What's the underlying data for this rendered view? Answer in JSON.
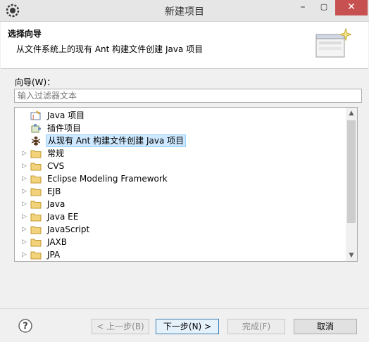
{
  "window": {
    "title": "新建项目",
    "minimize": "–",
    "maximize": "▢",
    "close": "✕"
  },
  "header": {
    "title": "选择向导",
    "description": "从文件系统上的现有 Ant 构建文件创建 Java 项目"
  },
  "wizards_label": "向导(W)：",
  "filter": {
    "placeholder": "输入过滤器文本",
    "value": ""
  },
  "tree": {
    "items": [
      {
        "label": "Java 项目",
        "icon": "java-project-icon",
        "expandable": false
      },
      {
        "label": "插件项目",
        "icon": "plugin-project-icon",
        "expandable": false
      },
      {
        "label": "从现有 Ant 构建文件创建 Java 项目",
        "icon": "ant-icon",
        "expandable": false,
        "selected": true
      },
      {
        "label": "常规",
        "icon": "folder-icon",
        "expandable": true
      },
      {
        "label": "CVS",
        "icon": "folder-icon",
        "expandable": true
      },
      {
        "label": "Eclipse Modeling Framework",
        "icon": "folder-icon",
        "expandable": true
      },
      {
        "label": "EJB",
        "icon": "folder-icon",
        "expandable": true
      },
      {
        "label": "Java",
        "icon": "folder-icon",
        "expandable": true
      },
      {
        "label": "Java EE",
        "icon": "folder-icon",
        "expandable": true
      },
      {
        "label": "JavaScript",
        "icon": "folder-icon",
        "expandable": true
      },
      {
        "label": "JAXB",
        "icon": "folder-icon",
        "expandable": true
      },
      {
        "label": "JPA",
        "icon": "folder-icon",
        "expandable": true
      }
    ]
  },
  "buttons": {
    "back": "< 上一步(B)",
    "next": "下一步(N) >",
    "finish": "完成(F)",
    "cancel": "取消"
  }
}
